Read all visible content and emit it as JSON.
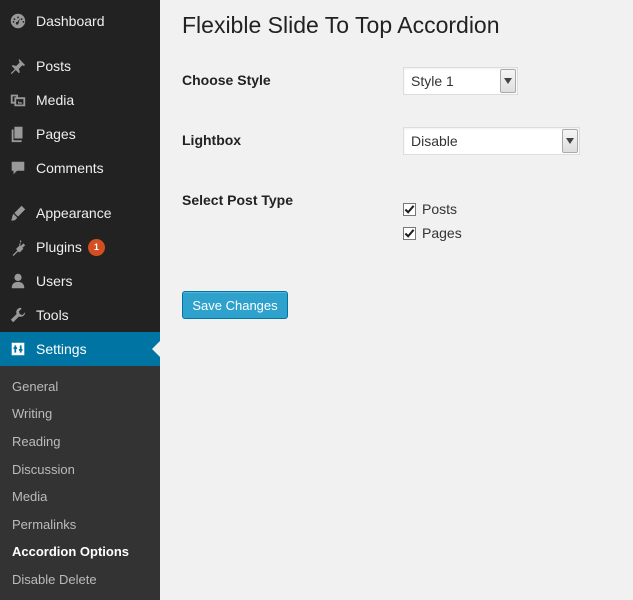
{
  "sidebar": {
    "items": [
      {
        "label": "Dashboard",
        "icon": "dashboard-icon"
      },
      {
        "label": "Posts",
        "icon": "pin-icon"
      },
      {
        "label": "Media",
        "icon": "media-icon"
      },
      {
        "label": "Pages",
        "icon": "pages-icon"
      },
      {
        "label": "Comments",
        "icon": "comment-icon"
      },
      {
        "label": "Appearance",
        "icon": "brush-icon"
      },
      {
        "label": "Plugins",
        "icon": "plugin-icon",
        "badge": "1"
      },
      {
        "label": "Users",
        "icon": "user-icon"
      },
      {
        "label": "Tools",
        "icon": "wrench-icon"
      },
      {
        "label": "Settings",
        "icon": "settings-icon",
        "current": true
      }
    ],
    "submenu": [
      "General",
      "Writing",
      "Reading",
      "Discussion",
      "Media",
      "Permalinks",
      "Accordion Options",
      "Disable Delete"
    ],
    "active_submenu": "Accordion Options",
    "colors": {
      "bg": "#222222",
      "submenu_bg": "#333333",
      "active": "#0074a2",
      "badge": "#d54e21"
    }
  },
  "main": {
    "title": "Flexible Slide To Top Accordion",
    "fields": {
      "style": {
        "label": "Choose Style",
        "value": "Style 1"
      },
      "lightbox": {
        "label": "Lightbox",
        "value": "Disable"
      },
      "post_type": {
        "label": "Select Post Type",
        "options": [
          {
            "label": "Posts",
            "checked": true
          },
          {
            "label": "Pages",
            "checked": true
          }
        ]
      }
    },
    "save_button": "Save Changes",
    "colors": {
      "button": "#2ea2cc",
      "button_border": "#0074a2"
    }
  }
}
